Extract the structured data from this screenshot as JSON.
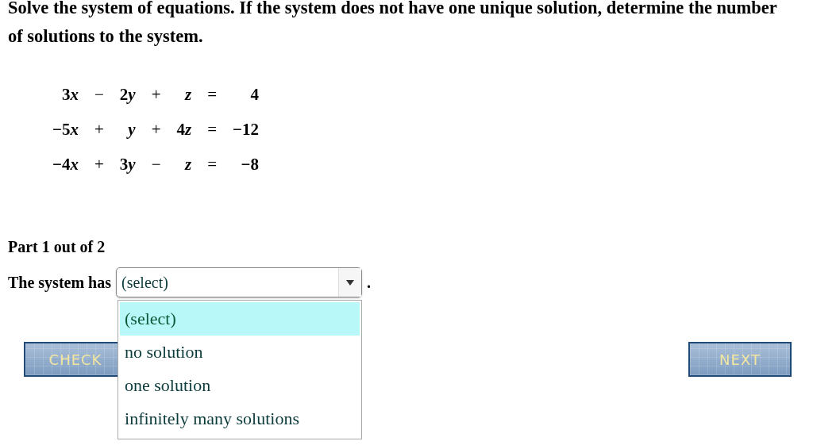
{
  "question": "Solve the system of equations. If the system does not have one unique solution, determine the number of solutions to the system.",
  "equations": [
    [
      {
        "coef": "3",
        "var": "x"
      },
      "−",
      {
        "coef": "2",
        "var": "y"
      },
      "+",
      {
        "var": "z"
      },
      "=",
      {
        "coef": "4"
      }
    ],
    [
      {
        "coef": "−5",
        "var": "x"
      },
      "+",
      {
        "var": "y"
      },
      "+",
      {
        "coef": "4",
        "var": "z"
      },
      "=",
      {
        "coef": "−12"
      }
    ],
    [
      {
        "coef": "−4",
        "var": "x"
      },
      "+",
      {
        "coef": "3",
        "var": "y"
      },
      "−",
      {
        "var": "z"
      },
      "=",
      {
        "coef": "−8"
      }
    ]
  ],
  "part_label": "Part 1 out of 2",
  "prompt": "The system has",
  "select": {
    "value": "(select)",
    "expanded": true,
    "options": [
      {
        "label": "(select)",
        "selected": true
      },
      {
        "label": "no solution",
        "selected": false
      },
      {
        "label": "one solution",
        "selected": false
      },
      {
        "label": "infinitely many solutions",
        "selected": false
      }
    ]
  },
  "trailing": ".",
  "buttons": [
    {
      "label": "CHECK"
    },
    {
      "label": "NEXT"
    }
  ]
}
